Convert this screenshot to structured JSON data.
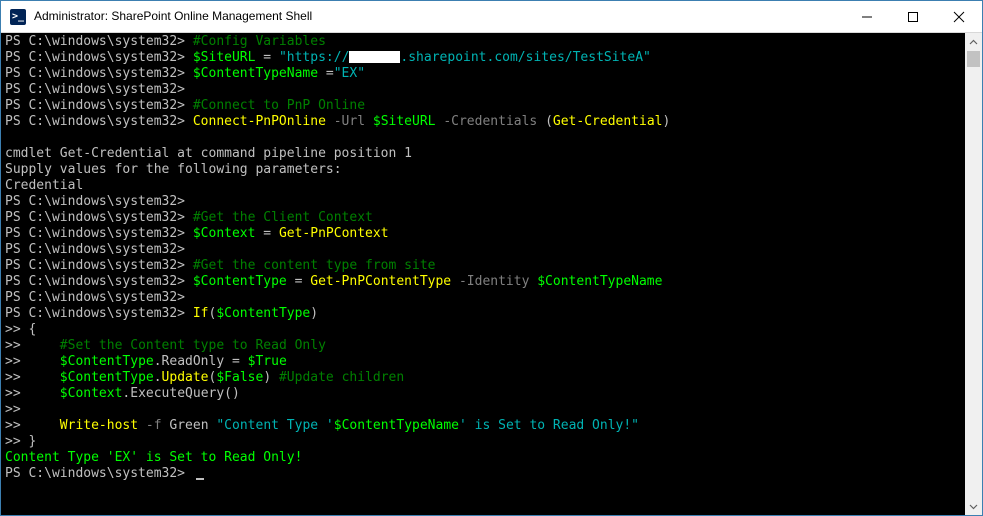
{
  "window": {
    "title": "Administrator: SharePoint Online Management Shell",
    "icons": {
      "app": "powershell-icon",
      "minimize": "minimize-icon",
      "maximize": "maximize-icon",
      "close": "close-icon"
    }
  },
  "console": {
    "lines": [
      [
        {
          "t": "PS C:\\windows\\system32> ",
          "c": "norm"
        },
        {
          "t": "#Config Variables",
          "c": "comment"
        }
      ],
      [
        {
          "t": "PS C:\\windows\\system32> ",
          "c": "norm"
        },
        {
          "t": "$SiteURL",
          "c": "var"
        },
        {
          "t": " = ",
          "c": "norm"
        },
        {
          "t": "\"https://",
          "c": "str"
        },
        {
          "t": "",
          "c": "redact"
        },
        {
          "t": ".sharepoint.com/sites/TestSiteA\"",
          "c": "str"
        }
      ],
      [
        {
          "t": "PS C:\\windows\\system32> ",
          "c": "norm"
        },
        {
          "t": "$ContentTypeName",
          "c": "var"
        },
        {
          "t": " =",
          "c": "norm"
        },
        {
          "t": "\"EX\"",
          "c": "str"
        }
      ],
      [
        {
          "t": "PS C:\\windows\\system32>",
          "c": "norm"
        }
      ],
      [
        {
          "t": "PS C:\\windows\\system32> ",
          "c": "norm"
        },
        {
          "t": "#Connect to PnP Online",
          "c": "comment"
        }
      ],
      [
        {
          "t": "PS C:\\windows\\system32> ",
          "c": "norm"
        },
        {
          "t": "Connect-PnPOnline",
          "c": "cmd"
        },
        {
          "t": " -Url ",
          "c": "param"
        },
        {
          "t": "$SiteURL",
          "c": "var"
        },
        {
          "t": " -Credentials ",
          "c": "param"
        },
        {
          "t": "(",
          "c": "norm"
        },
        {
          "t": "Get-Credential",
          "c": "cmd"
        },
        {
          "t": ")",
          "c": "norm"
        }
      ],
      [],
      [
        {
          "t": "cmdlet Get-Credential at command pipeline position 1",
          "c": "norm"
        }
      ],
      [
        {
          "t": "Supply values for the following parameters:",
          "c": "norm"
        }
      ],
      [
        {
          "t": "Credential",
          "c": "norm"
        }
      ],
      [
        {
          "t": "PS C:\\windows\\system32>",
          "c": "norm"
        }
      ],
      [
        {
          "t": "PS C:\\windows\\system32> ",
          "c": "norm"
        },
        {
          "t": "#Get the Client Context",
          "c": "comment"
        }
      ],
      [
        {
          "t": "PS C:\\windows\\system32> ",
          "c": "norm"
        },
        {
          "t": "$Context",
          "c": "var"
        },
        {
          "t": " = ",
          "c": "norm"
        },
        {
          "t": "Get-PnPContext",
          "c": "cmd"
        }
      ],
      [
        {
          "t": "PS C:\\windows\\system32>",
          "c": "norm"
        }
      ],
      [
        {
          "t": "PS C:\\windows\\system32> ",
          "c": "norm"
        },
        {
          "t": "#Get the content type from site",
          "c": "comment"
        }
      ],
      [
        {
          "t": "PS C:\\windows\\system32> ",
          "c": "norm"
        },
        {
          "t": "$ContentType",
          "c": "var"
        },
        {
          "t": " = ",
          "c": "norm"
        },
        {
          "t": "Get-PnPContentType",
          "c": "cmd"
        },
        {
          "t": " -Identity ",
          "c": "param"
        },
        {
          "t": "$ContentTypeName",
          "c": "var"
        }
      ],
      [
        {
          "t": "PS C:\\windows\\system32>",
          "c": "norm"
        }
      ],
      [
        {
          "t": "PS C:\\windows\\system32> ",
          "c": "norm"
        },
        {
          "t": "If",
          "c": "cmd"
        },
        {
          "t": "(",
          "c": "norm"
        },
        {
          "t": "$ContentType",
          "c": "var"
        },
        {
          "t": ")",
          "c": "norm"
        }
      ],
      [
        {
          "t": ">> {",
          "c": "norm"
        }
      ],
      [
        {
          "t": ">>     ",
          "c": "norm"
        },
        {
          "t": "#Set the Content type to Read Only",
          "c": "comment"
        }
      ],
      [
        {
          "t": ">>     ",
          "c": "norm"
        },
        {
          "t": "$ContentType",
          "c": "var"
        },
        {
          "t": ".ReadOnly = ",
          "c": "norm"
        },
        {
          "t": "$True",
          "c": "var"
        }
      ],
      [
        {
          "t": ">>     ",
          "c": "norm"
        },
        {
          "t": "$ContentType",
          "c": "var"
        },
        {
          "t": ".",
          "c": "norm"
        },
        {
          "t": "Update",
          "c": "cmd"
        },
        {
          "t": "(",
          "c": "norm"
        },
        {
          "t": "$False",
          "c": "var"
        },
        {
          "t": ") ",
          "c": "norm"
        },
        {
          "t": "#Update children",
          "c": "comment"
        }
      ],
      [
        {
          "t": ">>     ",
          "c": "norm"
        },
        {
          "t": "$Context",
          "c": "var"
        },
        {
          "t": ".ExecuteQuery()",
          "c": "norm"
        }
      ],
      [
        {
          "t": ">>",
          "c": "norm"
        }
      ],
      [
        {
          "t": ">>     ",
          "c": "norm"
        },
        {
          "t": "Write-host",
          "c": "cmd"
        },
        {
          "t": " -f ",
          "c": "param"
        },
        {
          "t": "Green ",
          "c": "norm"
        },
        {
          "t": "\"Content Type '",
          "c": "str"
        },
        {
          "t": "$ContentTypeName",
          "c": "var"
        },
        {
          "t": "' is Set to Read Only!\"",
          "c": "str"
        }
      ],
      [
        {
          "t": ">> }",
          "c": "norm"
        }
      ],
      [
        {
          "t": "Content Type 'EX' is Set to Read Only!",
          "c": "out"
        }
      ],
      [
        {
          "t": "PS C:\\windows\\system32> ",
          "c": "norm"
        }
      ]
    ]
  }
}
